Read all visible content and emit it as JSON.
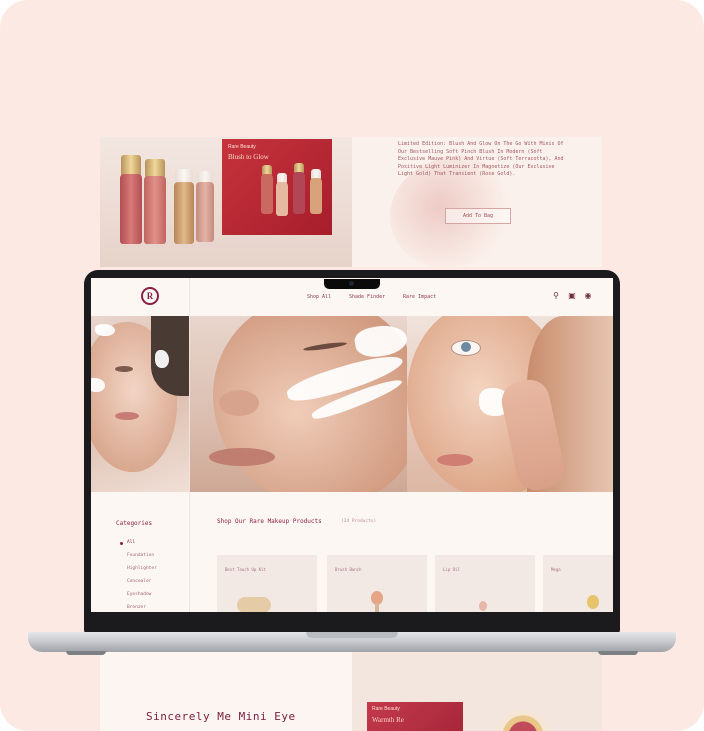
{
  "top_banner": {
    "box_brand": "Rare Beauty",
    "box_name": "Blush to Glow",
    "description": "Limited Edition: Blush And Glow On The Go With Minis Of Our Bestselling Soft Pinch Blush In Modern (Soft Exclusive Mauve Pink) And Virtue (Soft Terracotta), And Positive Light Luminizer In Magnetize (Our Exclusive Light Gold) That Transient (Rose Gold).",
    "button": "Add To Bag"
  },
  "site": {
    "nav": [
      "Shop All",
      "Shade Finder",
      "Rare Impact"
    ],
    "icons": [
      "search-icon",
      "bag-icon",
      "account-icon"
    ],
    "categories_title": "Categories",
    "categories": [
      "All",
      "Foundation",
      "Highlighter",
      "Concealer",
      "Eyeshadow",
      "Bronzer"
    ],
    "shop_title": "Shop Our Rare Makeup Products",
    "shop_count": "(24 Products)",
    "products": [
      {
        "label": "Best Touch Up Kit"
      },
      {
        "label": "Brush Bunch"
      },
      {
        "label": "Lip Oil"
      },
      {
        "label": "Mega"
      }
    ]
  },
  "bottom_banner": {
    "title": "Sincerely Me Mini Eye",
    "box_brand": "Rare Beauty",
    "box_name": "Warmth Re"
  },
  "colors": {
    "background": "#fde9e3",
    "accent": "#8a2246",
    "laptop": "#1b1b1d"
  }
}
